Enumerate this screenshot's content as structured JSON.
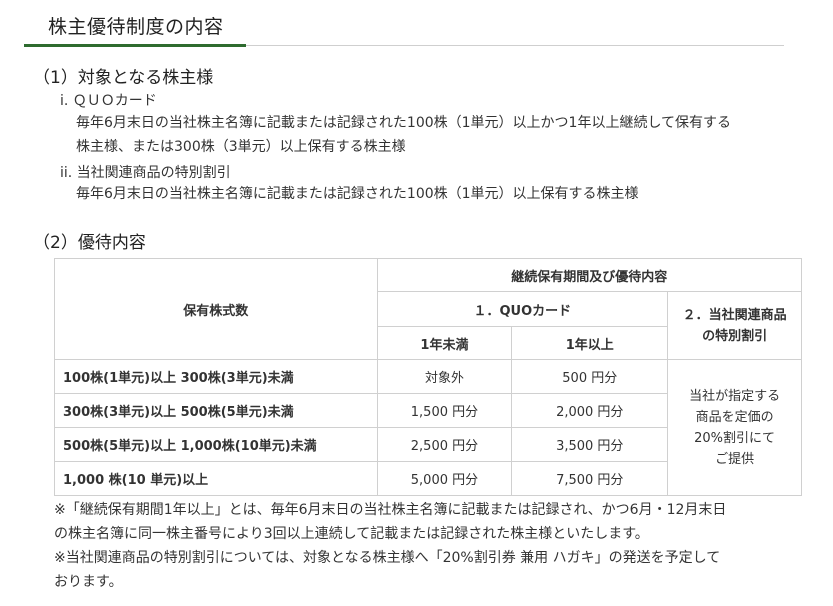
{
  "title": "株主優待制度の内容",
  "section1": {
    "heading": "（1）対象となる株主様",
    "items": [
      {
        "label": "i. ＱＵＯカード",
        "lines": [
          "毎年6月末日の当社株主名簿に記載または記録された100株（1単元）以上かつ1年以上継続して保有する",
          "株主様、または300株（3単元）以上保有する株主様"
        ]
      },
      {
        "label": "ii. 当社関連商品の特別割引",
        "lines": [
          "毎年6月末日の当社株主名簿に記載または記録された100株（1単元）以上保有する株主様"
        ]
      }
    ]
  },
  "section2": {
    "heading": "（2）優待内容"
  },
  "table": {
    "header_shares": "保有株式数",
    "header_group": "継続保有期間及び優待内容",
    "header_quo": "１．QUOカード",
    "header_under1": "1年未満",
    "header_over1": "1年以上",
    "header_discount_line1": "２．当社関連商品",
    "header_discount_line2": "の特別割引",
    "rows": [
      {
        "shares": "100株(1単元)以上 300株(3単元)未満",
        "under1": "対象外",
        "over1": "500 円分"
      },
      {
        "shares": "300株(3単元)以上 500株(5単元)未満",
        "under1": "1,500 円分",
        "over1": "2,000 円分"
      },
      {
        "shares": "500株(5単元)以上 1,000株(10単元)未満",
        "under1": "2,500 円分",
        "over1": "3,500 円分"
      },
      {
        "shares": "1,000 株(10 単元)以上",
        "under1": "5,000 円分",
        "over1": "7,500 円分"
      }
    ],
    "discount_lines": [
      "当社が指定する",
      "商品を定価の",
      "20%割引にて",
      "ご提供"
    ]
  },
  "notes": [
    "※「継続保有期間1年以上」とは、毎年6月末日の当社株主名簿に記載または記録され、かつ6月・12月末日",
    "の株主名簿に同一株主番号により3回以上連続して記載または記録された株主様といたします。",
    "※当社関連商品の特別割引については、対象となる株主様へ「20%割引券 兼用 ハガキ」の発送を予定して",
    "おります。"
  ],
  "colors": {
    "accent_green": "#2e6b2f",
    "rule_gray": "#cfcfcf",
    "text": "#333333"
  }
}
